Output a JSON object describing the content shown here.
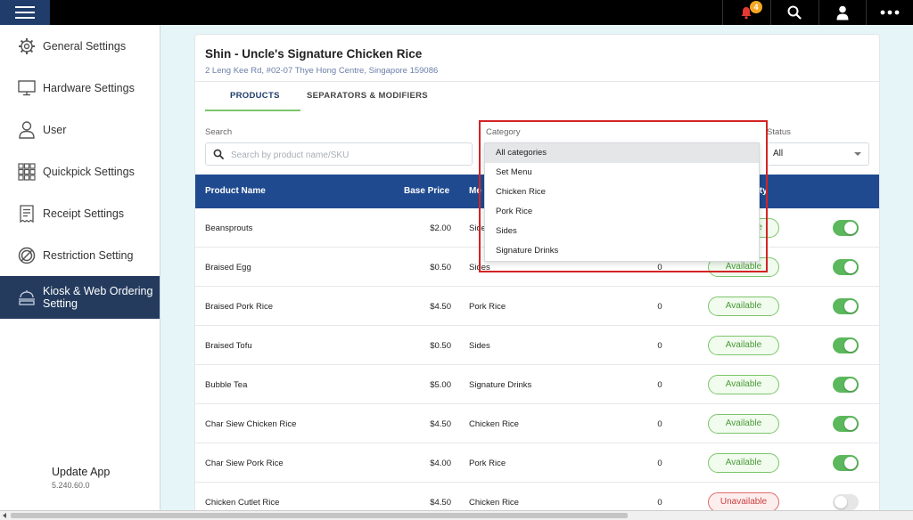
{
  "topbar": {
    "notifications_count": "4",
    "icons": [
      "hamburger-icon",
      "bell-icon",
      "search-icon",
      "user-icon",
      "more-icon"
    ]
  },
  "sidebar": {
    "items": [
      {
        "label": "General Settings",
        "icon": "gear-icon"
      },
      {
        "label": "Hardware Settings",
        "icon": "monitor-icon"
      },
      {
        "label": "User",
        "icon": "user-icon"
      },
      {
        "label": "Quickpick Settings",
        "icon": "grid-icon"
      },
      {
        "label": "Receipt Settings",
        "icon": "receipt-icon"
      },
      {
        "label": "Restriction Setting",
        "icon": "restriction-icon"
      },
      {
        "label": "Kiosk & Web Ordering Setting",
        "icon": "kiosk-icon",
        "active": true
      }
    ],
    "update_title": "Update App",
    "update_version": "5.240.60.0"
  },
  "store": {
    "name": "Shin - Uncle's Signature Chicken Rice",
    "address": "2 Leng Kee Rd, #02-07 Thye Hong Centre, Singapore 159086"
  },
  "tabs": [
    {
      "label": "PRODUCTS",
      "active": true
    },
    {
      "label": "SEPARATORS & MODIFIERS",
      "active": false
    }
  ],
  "filters": {
    "search_label": "Search",
    "search_placeholder": "Search by product name/SKU",
    "category_label": "Category",
    "status_label": "Status",
    "status_value": "All",
    "category_options": [
      "All categories",
      "Set Menu",
      "Chicken Rice",
      "Pork Rice",
      "Sides",
      "Signature Drinks"
    ],
    "category_selected": "All categories"
  },
  "table": {
    "headers": {
      "name": "Product Name",
      "price": "Base Price",
      "category": "Me",
      "availability": "ity"
    },
    "rows": [
      {
        "name": "Beansprouts",
        "price": "$2.00",
        "category": "Side",
        "qty": "",
        "status": "le",
        "enabled": true
      },
      {
        "name": "Braised Egg",
        "price": "$0.50",
        "category": "Sides",
        "qty": "0",
        "status": "Available",
        "enabled": true
      },
      {
        "name": "Braised Pork Rice",
        "price": "$4.50",
        "category": "Pork Rice",
        "qty": "0",
        "status": "Available",
        "enabled": true
      },
      {
        "name": "Braised Tofu",
        "price": "$0.50",
        "category": "Sides",
        "qty": "0",
        "status": "Available",
        "enabled": true
      },
      {
        "name": "Bubble Tea",
        "price": "$5.00",
        "category": "Signature Drinks",
        "qty": "0",
        "status": "Available",
        "enabled": true
      },
      {
        "name": "Char Siew Chicken Rice",
        "price": "$4.50",
        "category": "Chicken Rice",
        "qty": "0",
        "status": "Available",
        "enabled": true
      },
      {
        "name": "Char Siew Pork Rice",
        "price": "$4.00",
        "category": "Pork Rice",
        "qty": "0",
        "status": "Available",
        "enabled": true
      },
      {
        "name": "Chicken Cutlet Rice",
        "price": "$4.50",
        "category": "Chicken Rice",
        "qty": "0",
        "status": "Unavailable",
        "enabled": false
      }
    ]
  },
  "colors": {
    "header_blue": "#1f4a8f",
    "sidebar_active": "#243b5e",
    "available_green": "#4a9a38",
    "unavailable_red": "#c94040",
    "highlight_red": "#d42424",
    "toggle_on": "#5cb85c"
  }
}
